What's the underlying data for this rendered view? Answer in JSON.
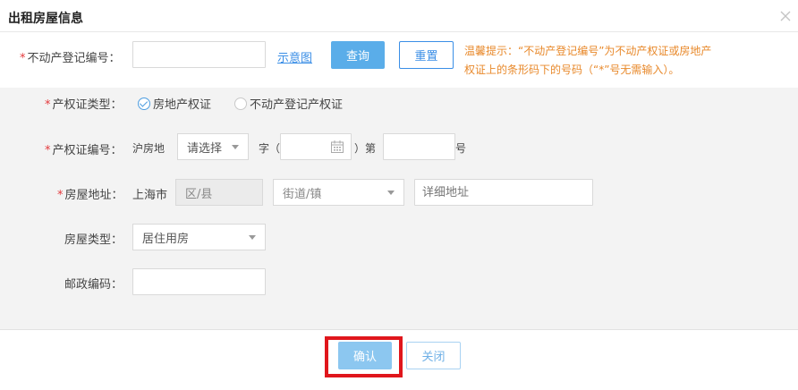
{
  "dialog": {
    "title": "出租房屋信息",
    "close_icon": "close-icon"
  },
  "registration": {
    "label": "不动产登记编号：",
    "input_value": "",
    "diagram_link": "示意图",
    "query_button": "查询",
    "reset_button": "重置",
    "tip_line1": "温馨提示：“不动产登记编号”为不动产权证或房地产",
    "tip_line2": "权证上的条形码下的号码（“*”号无需输入）。"
  },
  "cert_type": {
    "label": "产权证类型：",
    "options": [
      {
        "label": "房地产权证",
        "checked": true
      },
      {
        "label": "不动产登记产权证",
        "checked": false
      }
    ]
  },
  "cert_number": {
    "label": "产权证编号：",
    "prefix": "沪房地",
    "select_value": "请选择",
    "zi_label": "字（",
    "year_value": "",
    "calendar_icon": "calendar-icon",
    "di_label": "）第",
    "number_value": "",
    "hao_label": "号"
  },
  "address": {
    "label": "房屋地址：",
    "city": "上海市",
    "district_placeholder": "区/县",
    "street_placeholder": "街道/镇",
    "detail_placeholder": "详细地址"
  },
  "house_type": {
    "label": "房屋类型：",
    "value": "居住用房"
  },
  "postal": {
    "label": "邮政编码：",
    "value": ""
  },
  "footer": {
    "confirm_button": "确认",
    "close_button": "关闭"
  },
  "colors": {
    "primary": "#5aade9",
    "tip": "#e8892b",
    "required": "#e4393c",
    "highlight": "#e0161c"
  }
}
